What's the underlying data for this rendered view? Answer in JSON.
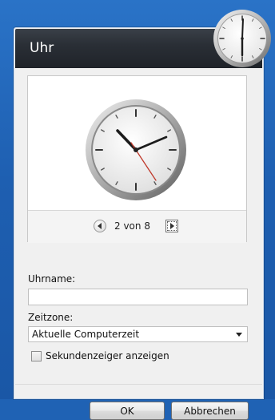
{
  "window": {
    "title": "Uhr"
  },
  "preview": {
    "pager_text": "2 von 8"
  },
  "fields": {
    "name_label": "Uhrname:",
    "name_value": "",
    "timezone_label": "Zeitzone:",
    "timezone_value": "Aktuelle Computerzeit"
  },
  "options": {
    "seconds_label": "Sekundenzeiger anzeigen",
    "seconds_checked": false
  },
  "buttons": {
    "ok": "OK",
    "cancel": "Abbrechen"
  },
  "icons": {
    "gadget": "analog-clock-icon",
    "preview": "analog-clock-icon",
    "prev": "circle-arrow-left-icon",
    "next": "arrow-right-icon",
    "dropdown": "chevron-down-icon"
  },
  "colors": {
    "desktop": "#1f62b4",
    "titlebar": "#2a2f36",
    "second_hand": "#c0392b"
  }
}
